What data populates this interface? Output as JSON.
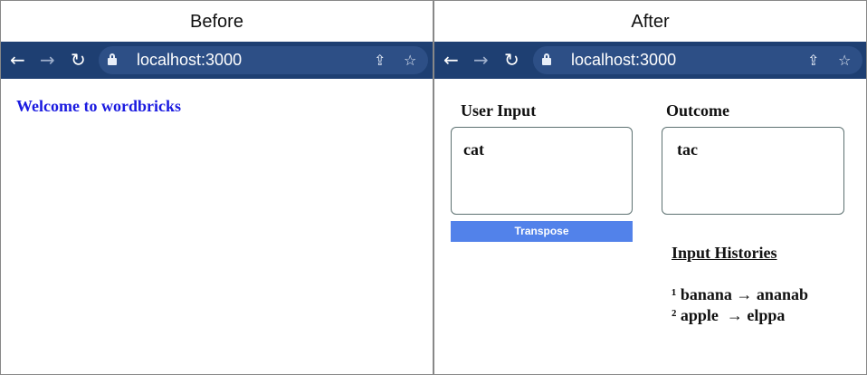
{
  "panels": {
    "before": {
      "title": "Before",
      "browser": {
        "back": "←",
        "forward": "→",
        "reload": "↻",
        "url": "localhost:3000",
        "share": "⇪",
        "star": "☆"
      },
      "page": {
        "welcome": "Welcome to wordbricks"
      }
    },
    "after": {
      "title": "After",
      "browser": {
        "back": "←",
        "forward": "→",
        "reload": "↻",
        "url": "localhost:3000",
        "share": "⇪",
        "star": "☆"
      },
      "page": {
        "user_input_label": "User Input",
        "user_input_value": "cat",
        "outcome_label": "Outcome",
        "outcome_value": "tac",
        "transpose_label": "Transpose",
        "histories_title": "Input Histories",
        "histories": [
          "¹ banana → ananab",
          "² apple  → elppa"
        ]
      }
    }
  },
  "colors": {
    "browser_bar": "#1e3f72",
    "address_bar": "#2d4f86",
    "welcome_text": "#1a1ae0",
    "button": "#5282ea",
    "box_border": "#5d7171"
  },
  "icons": {
    "back": "back-arrow-icon",
    "forward": "forward-arrow-icon",
    "reload": "reload-icon",
    "lock": "lock-icon",
    "share": "share-icon",
    "star": "bookmark-star-icon"
  }
}
